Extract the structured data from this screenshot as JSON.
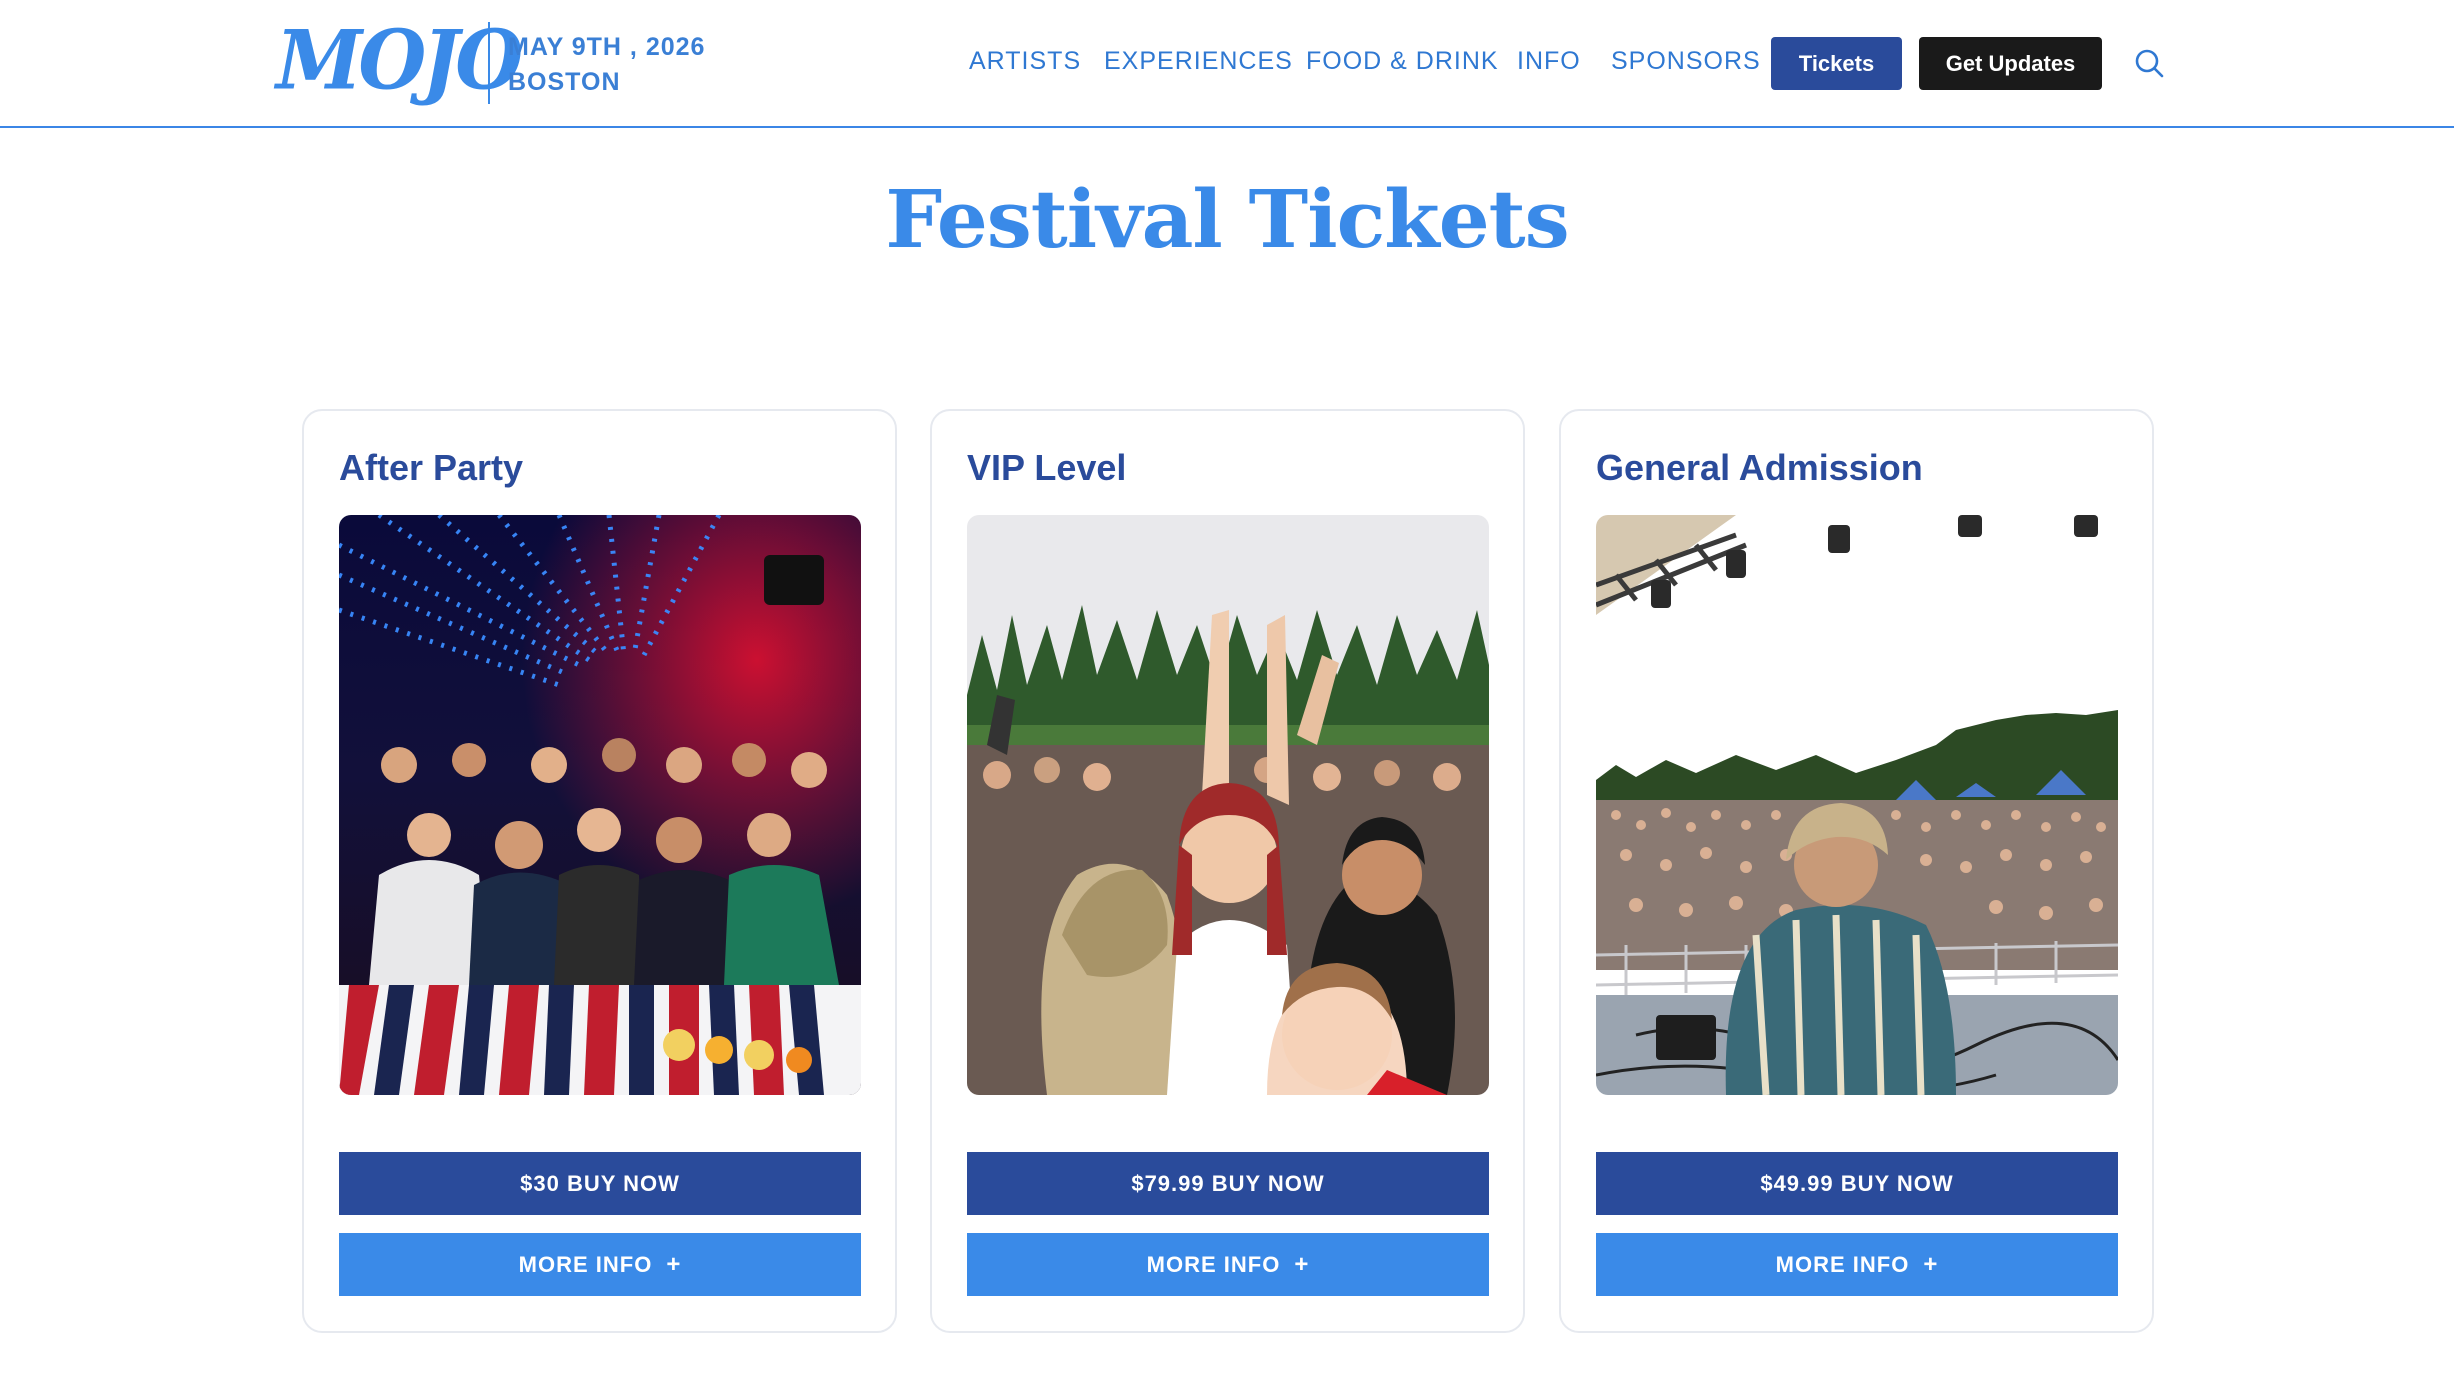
{
  "header": {
    "logo_text": "MOJO",
    "date": "MAY 9TH , 2026",
    "city": "BOSTON",
    "nav": [
      {
        "label": "ARTISTS"
      },
      {
        "label": "EXPERIENCES"
      },
      {
        "label": "FOOD & DRINK"
      },
      {
        "label": "INFO"
      },
      {
        "label": "SPONSORS"
      }
    ],
    "tickets_label": "Tickets",
    "updates_label": "Get Updates",
    "search_icon": "search-icon"
  },
  "main": {
    "title": "Festival Tickets",
    "cards": [
      {
        "title": "After Party",
        "buy_label": "$30 BUY NOW",
        "info_label": "MORE INFO",
        "image": "nightclub-crowd-photo"
      },
      {
        "title": "VIP Level",
        "buy_label": "$79.99 BUY NOW",
        "info_label": "MORE INFO",
        "image": "festival-crowd-cheering-photo"
      },
      {
        "title": "General Admission",
        "buy_label": "$49.99 BUY NOW",
        "info_label": "MORE INFO",
        "image": "stage-view-crowd-photo"
      }
    ]
  },
  "colors": {
    "brand_blue": "#3a8ae8",
    "navy": "#2a4b9b",
    "dark": "#1a1a1a"
  }
}
